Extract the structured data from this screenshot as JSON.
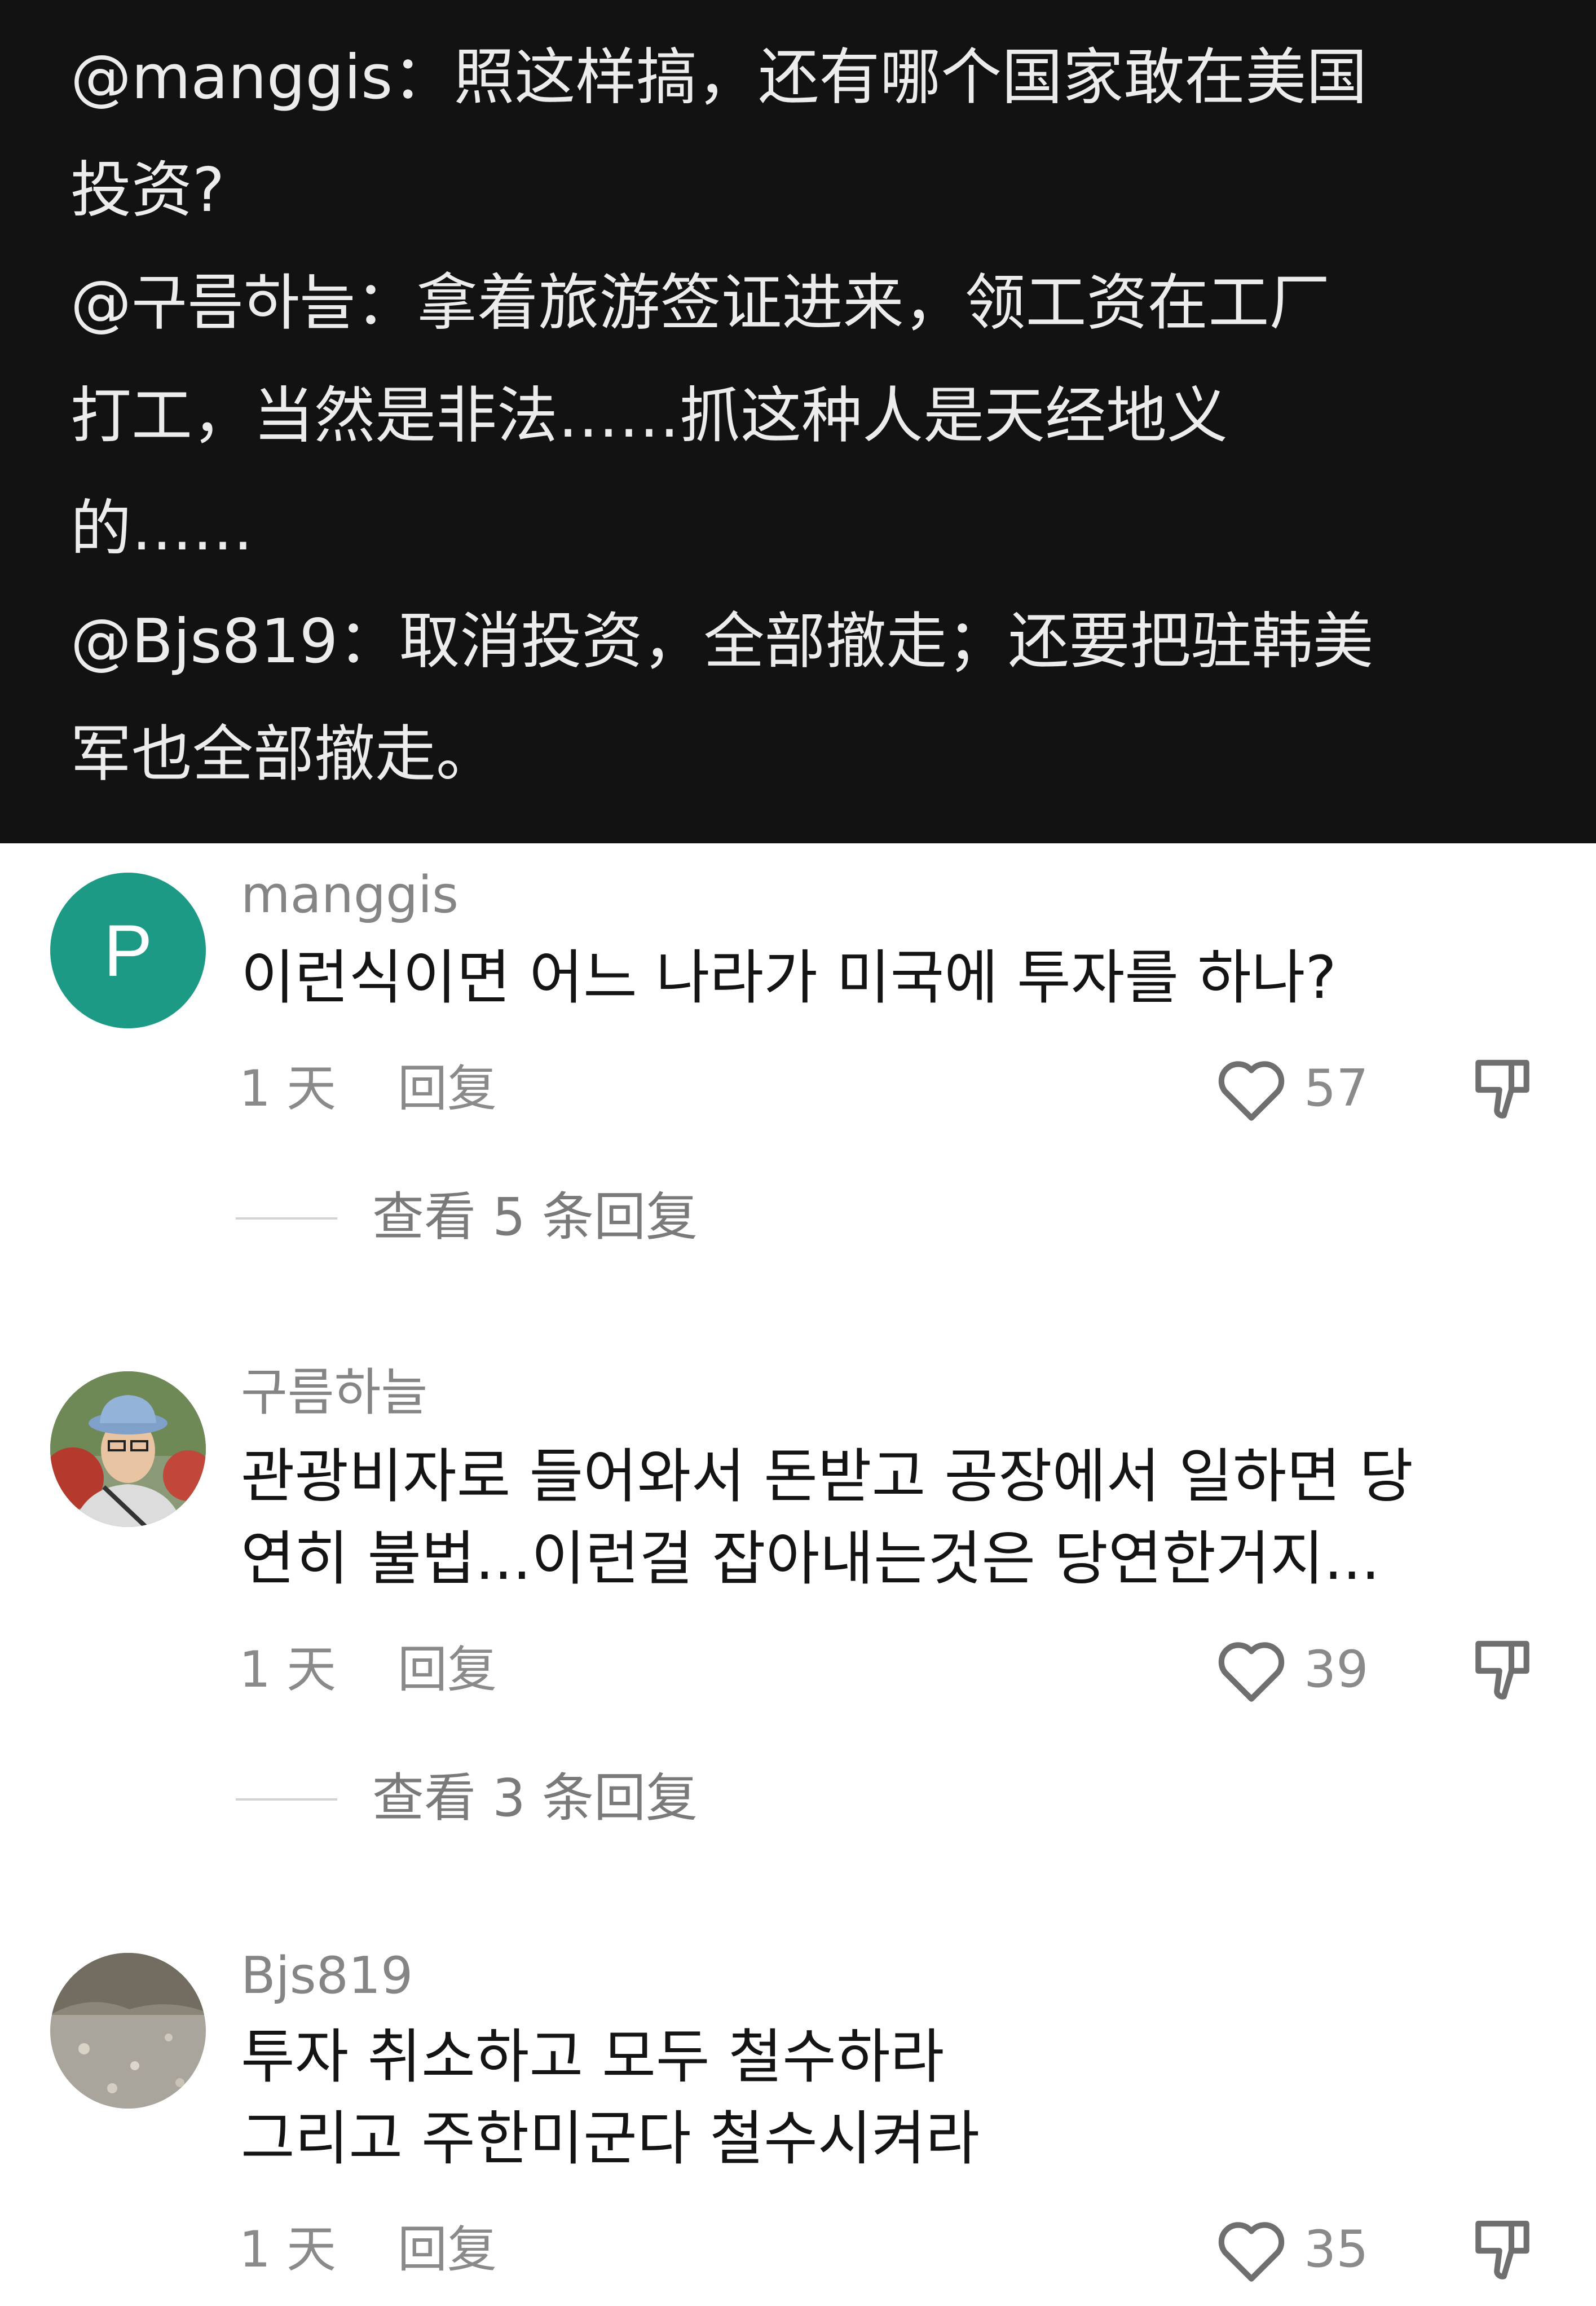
{
  "banner": {
    "lines": [
      "@manggis：照这样搞，还有哪个国家敢在美国",
      "投资?",
      "@구름하늘：拿着旅游签证进来，领工资在工厂",
      "打工，当然是非法……抓这种人是天经地义",
      "的……",
      "@Bjs819：取消投资，全部撤走；还要把驻韩美",
      "军也全部撤走。"
    ]
  },
  "comments": [
    {
      "username": "manggis",
      "avatar_letter": "P",
      "body": [
        "이런식이면 어느 나라가 미국에 투자를 하나?"
      ],
      "time": "1 天",
      "reply": "回复",
      "likes": "57",
      "view_replies": "查看 5 条回复"
    },
    {
      "username": "구름하늘",
      "body": [
        "관광비자로 들어와서 돈받고 공장에서 일하면 당",
        "연히 불법...이런걸 잡아내는것은 당연한거지..."
      ],
      "time": "1 天",
      "reply": "回复",
      "likes": "39",
      "view_replies": "查看 3 条回复"
    },
    {
      "username": "Bjs819",
      "body": [
        "투자 취소하고 모두 철수하라",
        "그리고 주한미군다 철수시켜라"
      ],
      "time": "1 天",
      "reply": "回复",
      "likes": "35"
    }
  ],
  "colors": {
    "banner_bg": "#121212",
    "avatar_p_bg": "#1d9a86"
  }
}
